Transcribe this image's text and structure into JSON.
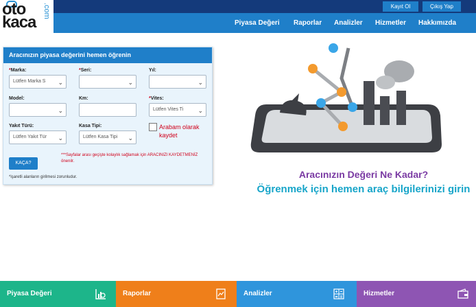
{
  "logo": {
    "line1": "oto",
    "line2": "kaca",
    "suffix": ".com"
  },
  "topbar": {
    "register_label": "Kayıt Ol",
    "logout_label": "Çıkış Yap"
  },
  "nav": [
    "Piyasa Değeri",
    "Raporlar",
    "Analizler",
    "Hizmetler",
    "Hakkımızda"
  ],
  "form": {
    "title": "Aracınızın piyasa değerini hemen öğrenin",
    "marka_label": "Marka:",
    "marka_value": "Lütfen Marka S",
    "seri_label": "Seri:",
    "yil_label": "Yıl:",
    "model_label": "Model:",
    "km_label": "Km:",
    "vites_label": "Vites:",
    "vites_value": "Lütfen Vites Ti",
    "yakit_label": "Yakıt Türü:",
    "yakit_value": "Lütfen Yakıt Tür",
    "kasa_label": "Kasa Tipi:",
    "kasa_value": "Lütfen Kasa Tipi",
    "save_label": "Arabam olarak kaydet",
    "submit_label": "KAÇA?",
    "warning": "***Sayfalar arası geçişte kolaylık sağlamak için ARACINIZI KAYDETMENİZ önenilr.",
    "required_note": "*işaretli alanların girilmesi zorunludur."
  },
  "headline": {
    "question": "Aracınızın Değeri Ne Kadar?",
    "cta": "Öğrenmek için hemen araç bilgilerinizi girin"
  },
  "tiles": [
    {
      "label": "Piyasa Değeri",
      "color": "#1db58a",
      "icon": "chart-magnifier-icon"
    },
    {
      "label": "Raporlar",
      "color": "#ef7f1a",
      "icon": "report-icon"
    },
    {
      "label": "Analizler",
      "color": "#2f95dc",
      "icon": "calculator-icon"
    },
    {
      "label": "Hizmetler",
      "color": "#8e55b3",
      "icon": "wallet-icon"
    }
  ],
  "colors": {
    "brand_blue": "#1f7fc9",
    "dark_blue": "#143a7b",
    "required_red": "#d0021b"
  }
}
